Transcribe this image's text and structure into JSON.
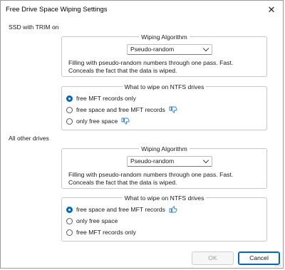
{
  "window": {
    "title": "Free Drive Space Wiping Settings",
    "close_icon": "close-icon"
  },
  "sections": [
    {
      "label": "SSD with TRIM on",
      "algorithm_title": "Wiping Algorithm",
      "algorithm_value": "Pseudo-random",
      "description_line1": "Filling with pseudo-random numbers through one pass. Fast.",
      "description_line2": "Conceals the fact that the data is wiped.",
      "ntfs_title": "What to wipe on NTFS drives",
      "options": [
        {
          "label": "free MFT records only",
          "selected": true,
          "thumb": null
        },
        {
          "label": "free space and free MFT records",
          "selected": false,
          "thumb": "thumbs-down-icon"
        },
        {
          "label": "only free space",
          "selected": false,
          "thumb": "thumbs-down-icon"
        }
      ]
    },
    {
      "label": "All other drives",
      "algorithm_title": "Wiping Algorithm",
      "algorithm_value": "Pseudo-random",
      "description_line1": "Filling with pseudo-random numbers through one pass. Fast.",
      "description_line2": "Conceals the fact that the data is wiped.",
      "ntfs_title": "What to wipe on NTFS drives",
      "options": [
        {
          "label": "free space and free MFT records",
          "selected": true,
          "thumb": "thumbs-up-icon"
        },
        {
          "label": "only free space",
          "selected": false,
          "thumb": null
        },
        {
          "label": "free MFT records only",
          "selected": false,
          "thumb": null
        }
      ]
    }
  ],
  "buttons": {
    "ok": "OK",
    "cancel": "Cancel"
  },
  "colors": {
    "accent": "#0067c0",
    "thumb": "#2f7fd6"
  }
}
